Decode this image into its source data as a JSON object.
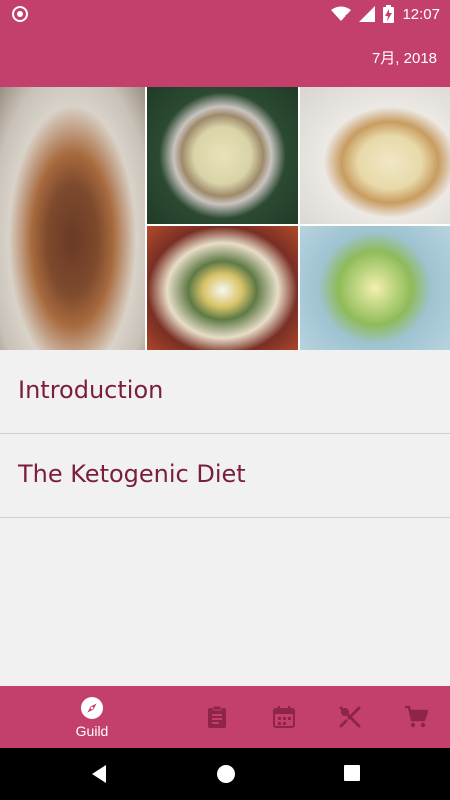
{
  "status_bar": {
    "time": "12:07",
    "icons": [
      "notification-icon",
      "wifi-icon",
      "signal-icon",
      "battery-charging-icon"
    ]
  },
  "app_bar": {
    "date": "7月, 2018"
  },
  "collage": {
    "images": [
      "beef-stew-image",
      "bacon-soup-image",
      "cheesecake-image",
      "cauliflower-rice-bowl-image",
      "zucchini-noodles-image"
    ]
  },
  "list": {
    "items": [
      {
        "label": "Introduction"
      },
      {
        "label": "The Ketogenic Diet"
      }
    ]
  },
  "bottom_nav": {
    "items": [
      {
        "label": "Guild",
        "icon": "compass-icon",
        "active": true
      },
      {
        "label": "",
        "icon": "clipboard-icon",
        "active": false
      },
      {
        "label": "",
        "icon": "calendar-icon",
        "active": false
      },
      {
        "label": "",
        "icon": "utensils-icon",
        "active": false
      },
      {
        "label": "",
        "icon": "cart-icon",
        "active": false
      }
    ]
  },
  "colors": {
    "primary": "#c2406b",
    "list_text": "#7a1e3c",
    "background": "#f1f1f1",
    "inactive_icon": "#8e2447"
  }
}
